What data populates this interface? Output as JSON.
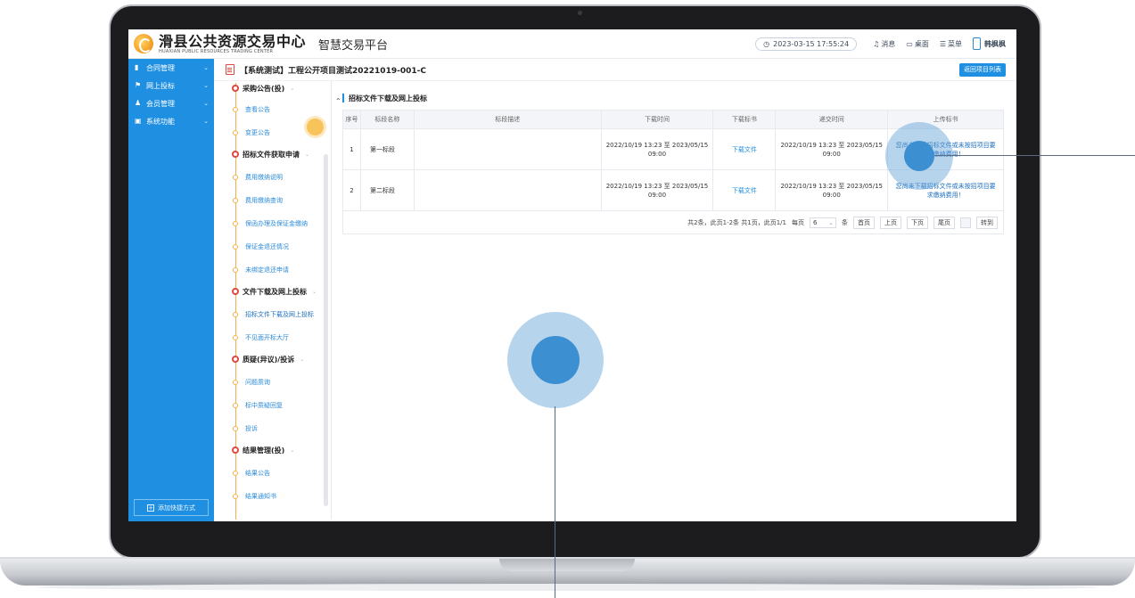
{
  "header": {
    "logo_cn": "滑县公共资源交易中心",
    "logo_en": "HUAXIAN PUBLIC RESOURCES TRADING CENTER",
    "platform": "智慧交易平台",
    "datetime": "2023-03-15 17:55:24",
    "messages_label": "消息",
    "desktop_label": "桌面",
    "menu_label": "菜单",
    "user_name": "韩枫枫"
  },
  "sidebar": {
    "items": [
      {
        "label": "合同管理",
        "icon": "contract-icon"
      },
      {
        "label": "网上投标",
        "icon": "bid-icon"
      },
      {
        "label": "会员管理",
        "icon": "member-icon"
      },
      {
        "label": "系统功能",
        "icon": "system-icon"
      }
    ],
    "add_shortcut_label": "添加快捷方式"
  },
  "titlebar": {
    "title": "【系统测试】工程公开项目测试20221019-001-C",
    "back_button": "返回项目列表"
  },
  "flow": {
    "groups": [
      {
        "label": "采购公告(投)",
        "subs": [
          "查看公告",
          "变更公告"
        ]
      },
      {
        "label": "招标文件获取申请",
        "subs": [
          "费用缴纳说明",
          "费用缴纳查询",
          "保函办理及保证金缴纳",
          "保证金退还情况",
          "未绑定退还申请"
        ]
      },
      {
        "label": "文件下载及网上投标",
        "subs": [
          "招标文件下载及网上投标",
          "不见面开标大厅"
        ]
      },
      {
        "label": "质疑(异议)/投诉",
        "subs": [
          "问题质询",
          "标中质疑回复",
          "投诉"
        ]
      },
      {
        "label": "结果管理(投)",
        "subs": [
          "结果公告",
          "结果通知书"
        ]
      }
    ]
  },
  "main": {
    "section_title": "招标文件下载及网上投标",
    "columns": [
      "序号",
      "标段名称",
      "标段描述",
      "下载时间",
      "下载标书",
      "递交时间",
      "上传标书"
    ],
    "rows": [
      {
        "no": "1",
        "name": "第一标段",
        "desc": "",
        "download_time_1": "2022/10/19 13:23 至 2023/05/15",
        "download_time_2": "09:00",
        "download_link": "下载文件",
        "submit_time_1": "2022/10/19 13:23 至 2023/05/15",
        "submit_time_2": "09:00",
        "upload_note_1": "您尚未下载招标文件或未按招项目要",
        "upload_note_2": "求缴纳费用！"
      },
      {
        "no": "2",
        "name": "第二标段",
        "desc": "",
        "download_time_1": "2022/10/19 13:23 至 2023/05/15",
        "download_time_2": "09:00",
        "download_link": "下载文件",
        "submit_time_1": "2022/10/19 13:23 至 2023/05/15",
        "submit_time_2": "09:00",
        "upload_note_1": "您尚未下载招标文件或未按招项目要",
        "upload_note_2": "求缴纳费用！"
      }
    ],
    "pager": {
      "summary": "共2条，此页1-2条 共1页，此页1/1",
      "per_page_label": "每页",
      "per_page_value": "6",
      "unit": "条",
      "first": "首页",
      "prev": "上页",
      "next": "下页",
      "last": "尾页",
      "goto": "转到"
    }
  },
  "colors": {
    "accent": "#1e8fe1",
    "flow_line": "#f3b04a",
    "group_dot": "#e0493f",
    "touch": "#3c8fd1"
  }
}
